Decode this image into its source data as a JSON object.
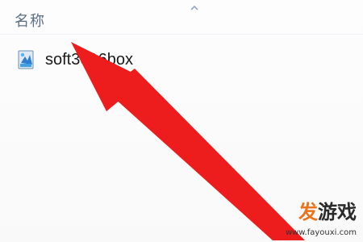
{
  "explorer": {
    "column_header": "名称",
    "file": {
      "name": "soft3e16box",
      "icon": "installer-icon"
    }
  },
  "annotation": {
    "type": "arrow",
    "color": "#ee1d1d",
    "points_to": "file-row"
  },
  "watermark": {
    "logo_part1": "发",
    "logo_part2": "游戏",
    "url": "www.fayouxi.com",
    "accent_color": "#e8741e"
  }
}
